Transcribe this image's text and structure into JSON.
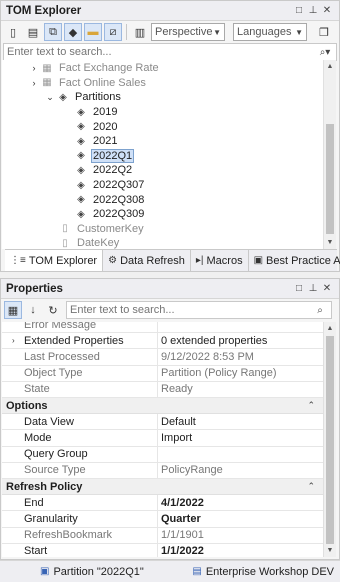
{
  "tom_explorer": {
    "title": "TOM Explorer",
    "perspectives": "Perspectives",
    "languages": "Languages",
    "search_placeholder": "Enter text to search...",
    "tree": [
      {
        "label": "Fact Exchange Rate",
        "expander": "›",
        "icon": "table-icon",
        "dim": true
      },
      {
        "label": "Fact Online Sales",
        "expander": "›",
        "icon": "table-icon",
        "dim": true
      },
      {
        "label": "Partitions",
        "expander": "⌄",
        "icon": "partitions-icon",
        "dim": false
      },
      {
        "label": "2019",
        "icon": "partition-icon"
      },
      {
        "label": "2020",
        "icon": "partition-icon"
      },
      {
        "label": "2021",
        "icon": "partition-icon"
      },
      {
        "label": "2022Q1",
        "icon": "partition-icon",
        "selected": true
      },
      {
        "label": "2022Q2",
        "icon": "partition-icon"
      },
      {
        "label": "2022Q307",
        "icon": "partition-icon"
      },
      {
        "label": "2022Q308",
        "icon": "partition-icon"
      },
      {
        "label": "2022Q309",
        "icon": "partition-icon"
      },
      {
        "label": "CustomerKey",
        "icon": "column-icon",
        "dim": true
      },
      {
        "label": "DateKey",
        "icon": "column-icon",
        "dim": true
      }
    ],
    "tabs": [
      {
        "label": "TOM Explorer",
        "icon": "tree-icon"
      },
      {
        "label": "Data Refresh",
        "icon": "refresh-icon"
      },
      {
        "label": "Macros",
        "icon": "macro-icon"
      },
      {
        "label": "Best Practice A...",
        "icon": "bpa-icon"
      }
    ]
  },
  "properties": {
    "title": "Properties",
    "search_placeholder": "Enter text to search...",
    "rows": [
      {
        "type": "prop",
        "key": "Error Message",
        "value": "",
        "ro": true
      },
      {
        "type": "prop",
        "key": "Extended Properties",
        "value": "0 extended properties",
        "expandable": true
      },
      {
        "type": "prop",
        "key": "Last Processed",
        "value": "9/12/2022 8:53 PM",
        "ro": true
      },
      {
        "type": "prop",
        "key": "Object Type",
        "value": "Partition (Policy Range)",
        "ro": true
      },
      {
        "type": "prop",
        "key": "State",
        "value": "Ready",
        "ro": true
      },
      {
        "type": "cat",
        "key": "Options"
      },
      {
        "type": "prop",
        "key": "Data View",
        "value": "Default"
      },
      {
        "type": "prop",
        "key": "Mode",
        "value": "Import"
      },
      {
        "type": "prop",
        "key": "Query Group",
        "value": ""
      },
      {
        "type": "prop",
        "key": "Source Type",
        "value": "PolicyRange",
        "ro": true
      },
      {
        "type": "cat",
        "key": "Refresh Policy"
      },
      {
        "type": "prop",
        "key": "End",
        "value": "4/1/2022",
        "bold": true
      },
      {
        "type": "prop",
        "key": "Granularity",
        "value": "Quarter",
        "bold": true
      },
      {
        "type": "prop",
        "key": "RefreshBookmark",
        "value": "1/1/1901",
        "ro": true
      },
      {
        "type": "prop",
        "key": "Start",
        "value": "1/1/2022",
        "bold": true
      }
    ]
  },
  "status": {
    "object": "Partition \"2022Q1\"",
    "model": "Enterprise Workshop DEV"
  }
}
